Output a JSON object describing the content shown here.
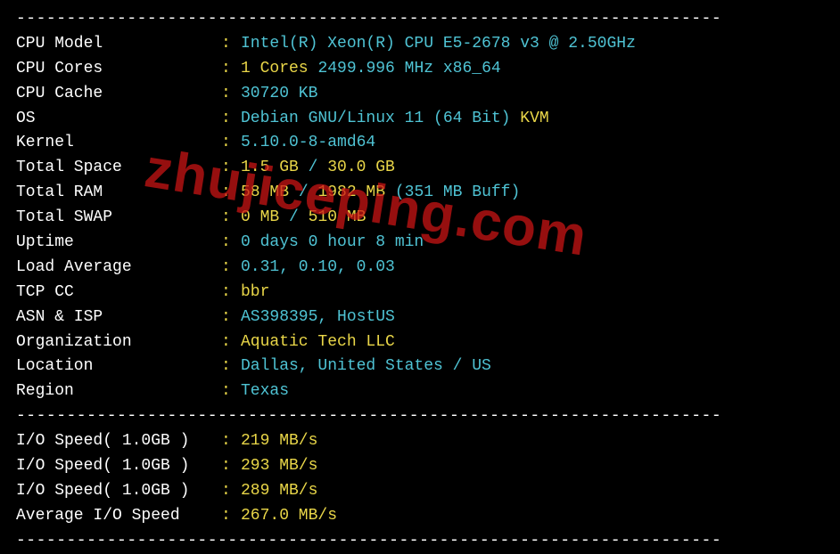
{
  "divider": "----------------------------------------------------------------------",
  "info": {
    "cpu_model": {
      "label": "CPU Model",
      "value": "Intel(R) Xeon(R) CPU E5-2678 v3 @ 2.50GHz"
    },
    "cpu_cores": {
      "label": "CPU Cores",
      "value_num": "1 Cores",
      "value_freq": "2499.996 MHz",
      "value_arch": "x86_64"
    },
    "cpu_cache": {
      "label": "CPU Cache",
      "value": "30720 KB"
    },
    "os": {
      "label": "OS",
      "value": "Debian GNU/Linux 11 (64 Bit)",
      "virt": "KVM"
    },
    "kernel": {
      "label": "Kernel",
      "value": "5.10.0-8-amd64"
    },
    "total_space": {
      "label": "Total Space",
      "used": "1.5 GB",
      "total": "30.0 GB"
    },
    "total_ram": {
      "label": "Total RAM",
      "used": "58 MB",
      "total": "1982 MB",
      "buff": "(351 MB Buff)"
    },
    "total_swap": {
      "label": "Total SWAP",
      "used": "0 MB",
      "total": "510 MB"
    },
    "uptime": {
      "label": "Uptime",
      "value": "0 days 0 hour 8 min"
    },
    "load_average": {
      "label": "Load Average",
      "value": "0.31, 0.10, 0.03"
    },
    "tcp_cc": {
      "label": "TCP CC",
      "value": "bbr"
    },
    "asn_isp": {
      "label": "ASN & ISP",
      "value": "AS398395, HostUS"
    },
    "organization": {
      "label": "Organization",
      "value": "Aquatic Tech LLC"
    },
    "location": {
      "label": "Location",
      "value": "Dallas, United States / US"
    },
    "region": {
      "label": "Region",
      "value": "Texas"
    }
  },
  "io": {
    "test1": {
      "label": "I/O Speed( 1.0GB )",
      "value": "219 MB/s"
    },
    "test2": {
      "label": "I/O Speed( 1.0GB )",
      "value": "293 MB/s"
    },
    "test3": {
      "label": "I/O Speed( 1.0GB )",
      "value": "289 MB/s"
    },
    "average": {
      "label": "Average I/O Speed",
      "value": "267.0 MB/s"
    }
  },
  "watermark": "zhujiceping.com",
  "slash": " / "
}
